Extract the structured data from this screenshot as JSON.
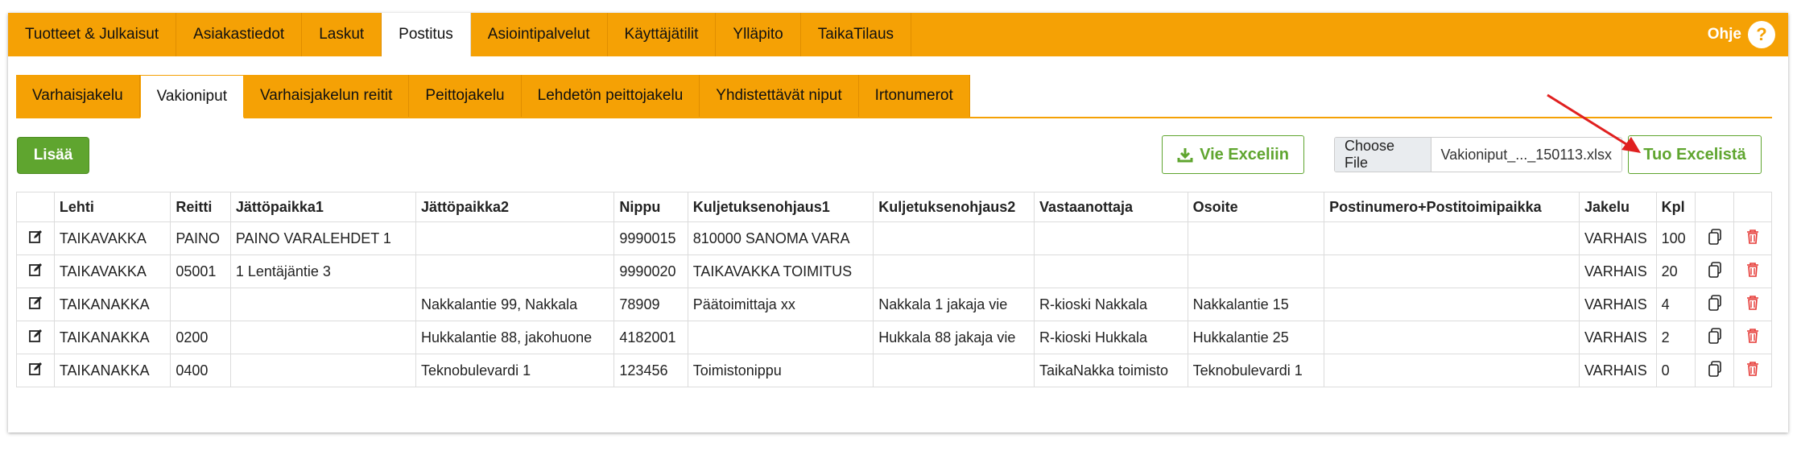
{
  "topnav": {
    "items": [
      "Tuotteet & Julkaisut",
      "Asiakastiedot",
      "Laskut",
      "Postitus",
      "Asiointipalvelut",
      "Käyttäjätilit",
      "Ylläpito",
      "TaikaTilaus"
    ],
    "help_label": "Ohje",
    "help_icon": "?"
  },
  "subnav": {
    "items": [
      "Varhaisjakelu",
      "Vakioniput",
      "Varhaisjakelun reitit",
      "Peittojakelu",
      "Lehdetön peittojakelu",
      "Yhdistettävät niput",
      "Irtonumerot"
    ]
  },
  "toolbar": {
    "add_label": "Lisää",
    "export_label": "Vie Exceliin",
    "choose_file_label": "Choose File",
    "file_name": "Vakioniput_..._150113.xlsx",
    "import_label": "Tuo Excelistä"
  },
  "colors": {
    "accent": "#f5a105",
    "green": "#5fa52f",
    "delete": "#e53935"
  },
  "table": {
    "headers": [
      "",
      "Lehti",
      "Reitti",
      "Jättöpaikka1",
      "Jättöpaikka2",
      "Nippu",
      "Kuljetuksenohjaus1",
      "Kuljetuksenohjaus2",
      "Vastaanottaja",
      "Osoite",
      "Postinumero+Postitoimipaikka",
      "Jakelu",
      "Kpl",
      "",
      ""
    ],
    "rows": [
      [
        "TAIKAVAKKA",
        "PAINO",
        "PAINO VARALEHDET 1",
        "",
        "9990015",
        "810000 SANOMA VARA",
        "",
        "",
        "",
        "",
        "VARHAIS",
        "100"
      ],
      [
        "TAIKAVAKKA",
        "05001",
        "1 Lentäjäntie 3",
        "",
        "9990020",
        "TAIKAVAKKA TOIMITUS",
        "",
        "",
        "",
        "",
        "VARHAIS",
        "20"
      ],
      [
        "TAIKANAKKA",
        "",
        "",
        "Nakkalantie 99, Nakkala",
        "78909",
        "Päätoimittaja xx",
        "Nakkala 1 jakaja vie",
        "R-kioski Nakkala",
        "Nakkalantie 15",
        "",
        "VARHAIS",
        "4"
      ],
      [
        "TAIKANAKKA",
        "0200",
        "",
        "Hukkalantie 88, jakohuone",
        "4182001",
        "",
        "Hukkala 88 jakaja vie",
        "R-kioski Hukkala",
        "Hukkalantie 25",
        "",
        "VARHAIS",
        "2"
      ],
      [
        "TAIKANAKKA",
        "0400",
        "",
        "Teknobulevardi 1",
        "123456",
        "Toimistonippu",
        "",
        "TaikaNakka toimisto",
        "Teknobulevardi 1",
        "",
        "VARHAIS",
        "0"
      ]
    ]
  }
}
